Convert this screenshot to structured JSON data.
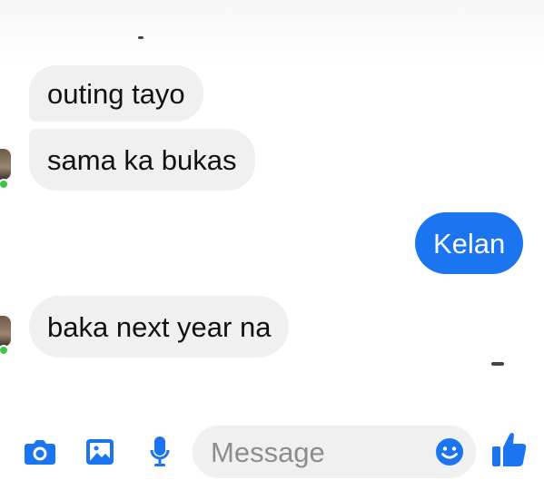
{
  "messages": [
    {
      "sender": "other",
      "text": "outing tayo"
    },
    {
      "sender": "other",
      "text": "sama ka bukas"
    },
    {
      "sender": "me",
      "text": "Kelan"
    },
    {
      "sender": "other",
      "text": "baka next year na"
    }
  ],
  "composer": {
    "placeholder": "Message",
    "icons": [
      "camera-icon",
      "gallery-icon",
      "microphone-icon",
      "emoji-icon",
      "thumbs-up-icon"
    ]
  },
  "colors": {
    "accent": "#1b74f0",
    "incoming_bubble": "#f1f0f0",
    "online": "#3ec644"
  }
}
